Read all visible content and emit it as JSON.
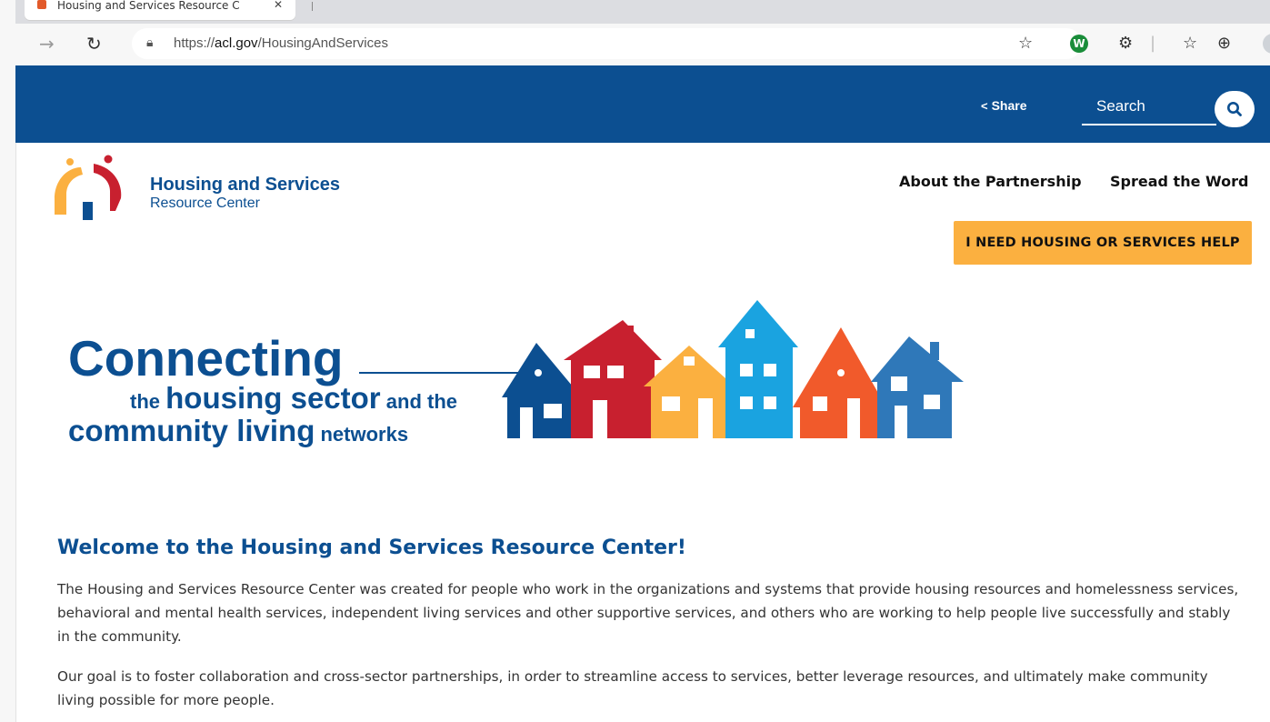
{
  "browser": {
    "tab_title": "Housing and Services Resource C",
    "url_prefix": "https://",
    "url_host": "acl.gov",
    "url_path": "/HousingAndServices",
    "extension_letter": "W"
  },
  "topbar": {
    "share_label": "Share",
    "search_placeholder": "Search"
  },
  "logo": {
    "title": "Housing and Services",
    "subtitle": "Resource Center"
  },
  "nav": {
    "about": "About the Partnership",
    "spread": "Spread the Word",
    "help_button": "I NEED HOUSING OR SERVICES HELP"
  },
  "banner": {
    "line1": "Connecting",
    "line2_pre": "the ",
    "line2_big": "housing sector",
    "line2_post": " and the",
    "line3_big": "community living",
    "line3_post": " networks"
  },
  "content": {
    "heading": "Welcome to the Housing and Services Resource Center!",
    "paragraph1": "The Housing and Services Resource Center was created for people who work in the organizations and systems that provide housing resources and homelessness services, behavioral and mental health services, independent living services and other supportive services, and others who are working to help people live successfully and stably in the community.",
    "paragraph2": "Our goal is to foster collaboration and cross-sector partnerships, in order to streamline access to services, better leverage resources, and ultimately make community living possible for more people."
  },
  "colors": {
    "brand_blue": "#0c4f91",
    "accent_orange": "#fbb040",
    "house_red": "#c8202f",
    "house_sky": "#1aa3e0",
    "house_coral": "#f15a2b",
    "house_steel": "#2f78b9"
  }
}
